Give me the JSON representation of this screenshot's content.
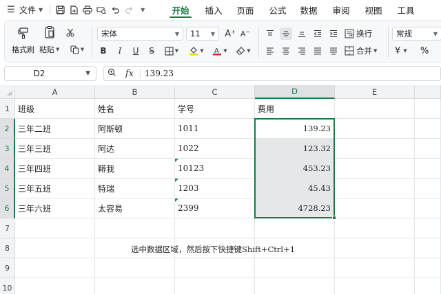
{
  "menubar": {
    "file_label": "文件",
    "tabs": [
      "开始",
      "插入",
      "页面",
      "公式",
      "数据",
      "审阅",
      "视图",
      "工具"
    ],
    "active_tab": "开始"
  },
  "ribbon": {
    "format_painter": "格式刷",
    "paste": "粘贴",
    "font_name": "宋体",
    "font_size": "11",
    "wrap_text": "换行",
    "merge": "合并",
    "number_format": "常规",
    "currency_symbol": "¥",
    "percent_symbol": "%"
  },
  "formula_bar": {
    "name_box": "D2",
    "fx_symbol": "fx",
    "value": "139.23"
  },
  "sheet": {
    "columns": [
      "A",
      "B",
      "C",
      "D",
      "E"
    ],
    "rows": [
      "1",
      "2",
      "3",
      "4",
      "5",
      "6",
      "7",
      "8",
      "9",
      "10"
    ],
    "header_row": [
      "班级",
      "姓名",
      "学号",
      "费用"
    ],
    "data": [
      [
        "三年二班",
        "阿斯顿",
        "1011",
        "139.23"
      ],
      [
        "三年三班",
        "阿达",
        "1022",
        "123.32"
      ],
      [
        "三年四班",
        "鞯我",
        "10123",
        "453.23"
      ],
      [
        "三年五班",
        "特瑞",
        "1203",
        "45.43"
      ],
      [
        "三年六班",
        "太容易",
        "2399",
        "4728.23"
      ]
    ],
    "note": "选中数据区域，然后按下快捷键Shift+Ctrl+1"
  },
  "colors": {
    "accent": "#1a7a44",
    "selection_fill": "#e5e7e9"
  }
}
